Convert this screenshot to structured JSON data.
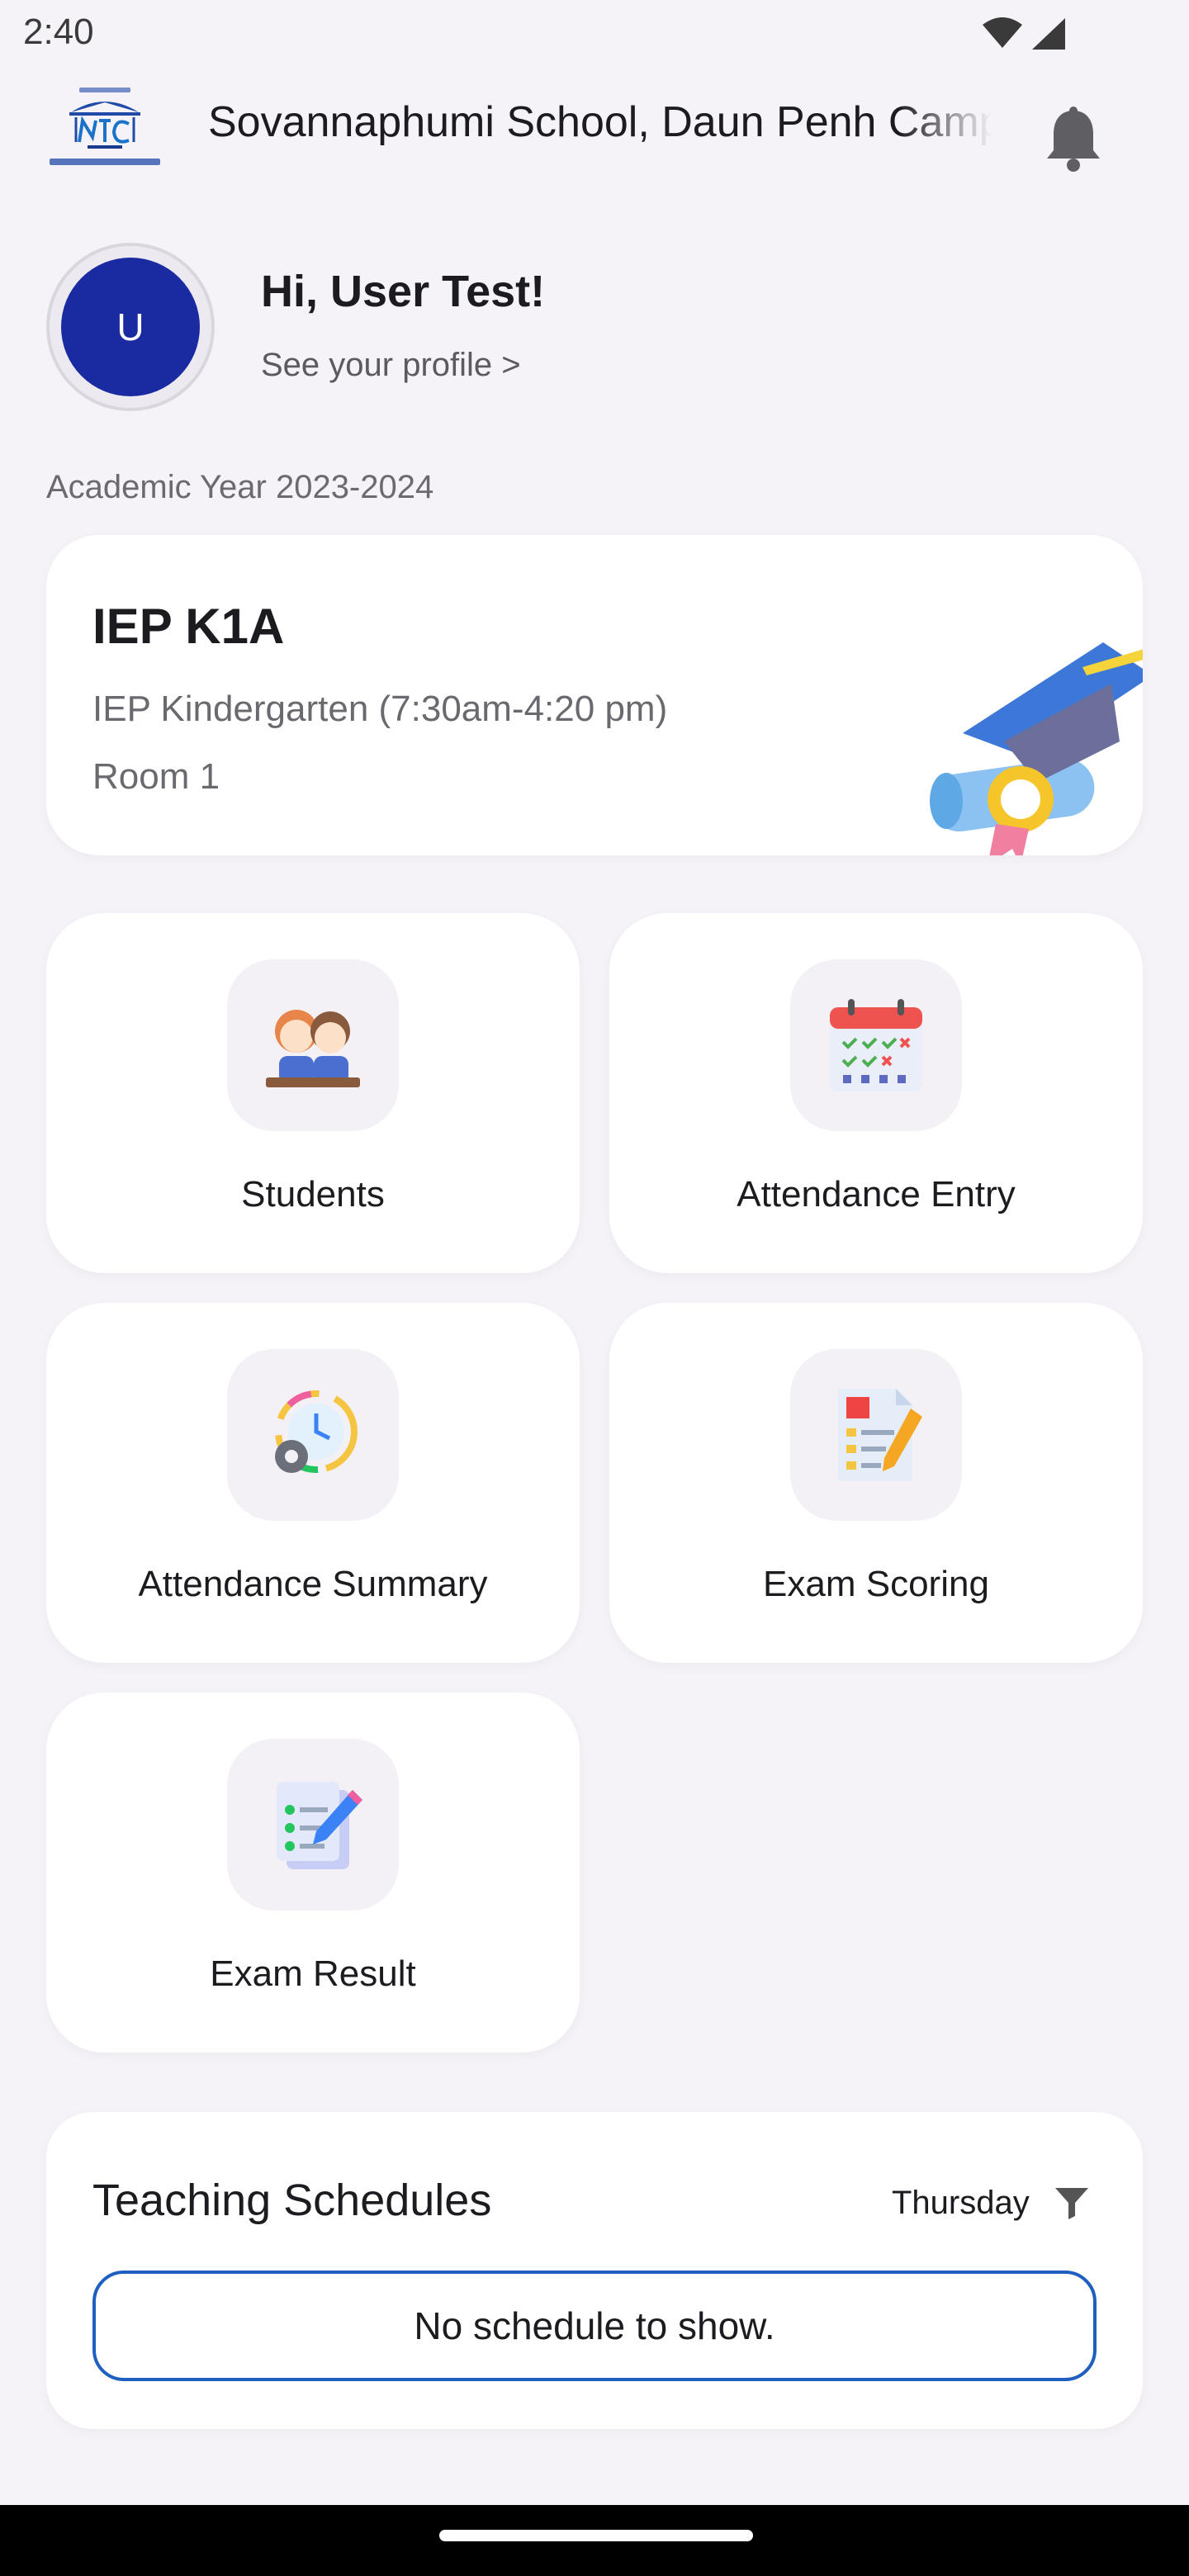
{
  "status_bar": {
    "time": "2:40"
  },
  "header": {
    "school_name": "Sovannaphumi School, Daun Penh Campus"
  },
  "profile": {
    "avatar_initial": "U",
    "greeting": "Hi, User Test!",
    "profile_link": "See your profile >"
  },
  "academic_year": "Academic Year 2023-2024",
  "class_card": {
    "title": "IEP K1A",
    "program": "IEP Kindergarten (7:30am-4:20 pm)",
    "room": "Room 1"
  },
  "tiles": [
    {
      "label": "Students",
      "icon": "students-icon"
    },
    {
      "label": "Attendance Entry",
      "icon": "calendar-check-icon"
    },
    {
      "label": "Attendance Summary",
      "icon": "clock-gear-icon"
    },
    {
      "label": "Exam Scoring",
      "icon": "exam-paper-pencil-icon"
    },
    {
      "label": "Exam Result",
      "icon": "checklist-pencil-icon"
    }
  ],
  "schedules": {
    "title": "Teaching Schedules",
    "day": "Thursday",
    "empty_message": "No schedule to show."
  },
  "colors": {
    "avatar": "#1a2aa0",
    "background": "#f5f3f7",
    "schedule_border": "#1f5fbf"
  }
}
